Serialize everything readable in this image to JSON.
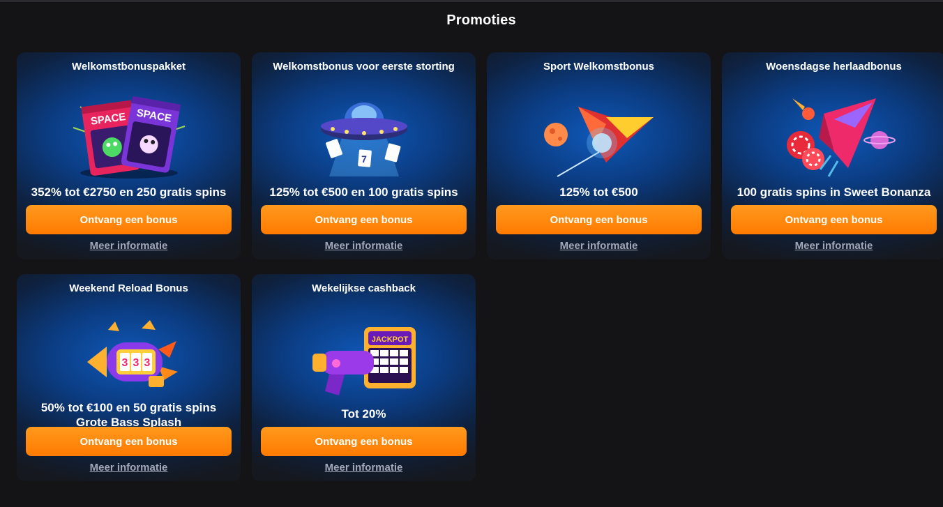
{
  "page": {
    "title": "Promoties"
  },
  "promotions": [
    {
      "title": "Welkomstbonuspakket",
      "description": "352% tot €2750 en 250 gratis spins",
      "description_line2": "",
      "button": "Ontvang een bonus",
      "link": "Meer informatie",
      "icon": "space-food-bags-icon"
    },
    {
      "title": "Welkomstbonus voor eerste storting",
      "description": "125% tot €500 en 100 gratis spins",
      "description_line2": "",
      "button": "Ontvang een bonus",
      "link": "Meer informatie",
      "icon": "ufo-cards-icon"
    },
    {
      "title": "Sport Welkomstbonus",
      "description": "125% tot €500",
      "description_line2": "",
      "button": "Ontvang een bonus",
      "link": "Meer informatie",
      "icon": "rocket-planet-icon"
    },
    {
      "title": "Woensdagse herlaadbonus",
      "description": "100 gratis spins in Sweet Bonanza",
      "description_line2": "",
      "button": "Ontvang een bonus",
      "link": "Meer informatie",
      "icon": "spaceship-chips-icon"
    },
    {
      "title": "Weekend Reload Bonus",
      "description": "50% tot €100 en 50 gratis spins",
      "description_line2": "Grote Bass Splash",
      "button": "Ontvang een bonus",
      "link": "Meer informatie",
      "icon": "slot-rocket-icon"
    },
    {
      "title": "Wekelijkse cashback",
      "description": "Tot 20%",
      "description_line2": "",
      "button": "Ontvang een bonus",
      "link": "Meer informatie",
      "icon": "jackpot-blaster-icon"
    }
  ],
  "colors": {
    "background": "#141416",
    "button": "#ff8a0a",
    "card_glow": "#0f58b8",
    "link": "#a2a8b8"
  }
}
